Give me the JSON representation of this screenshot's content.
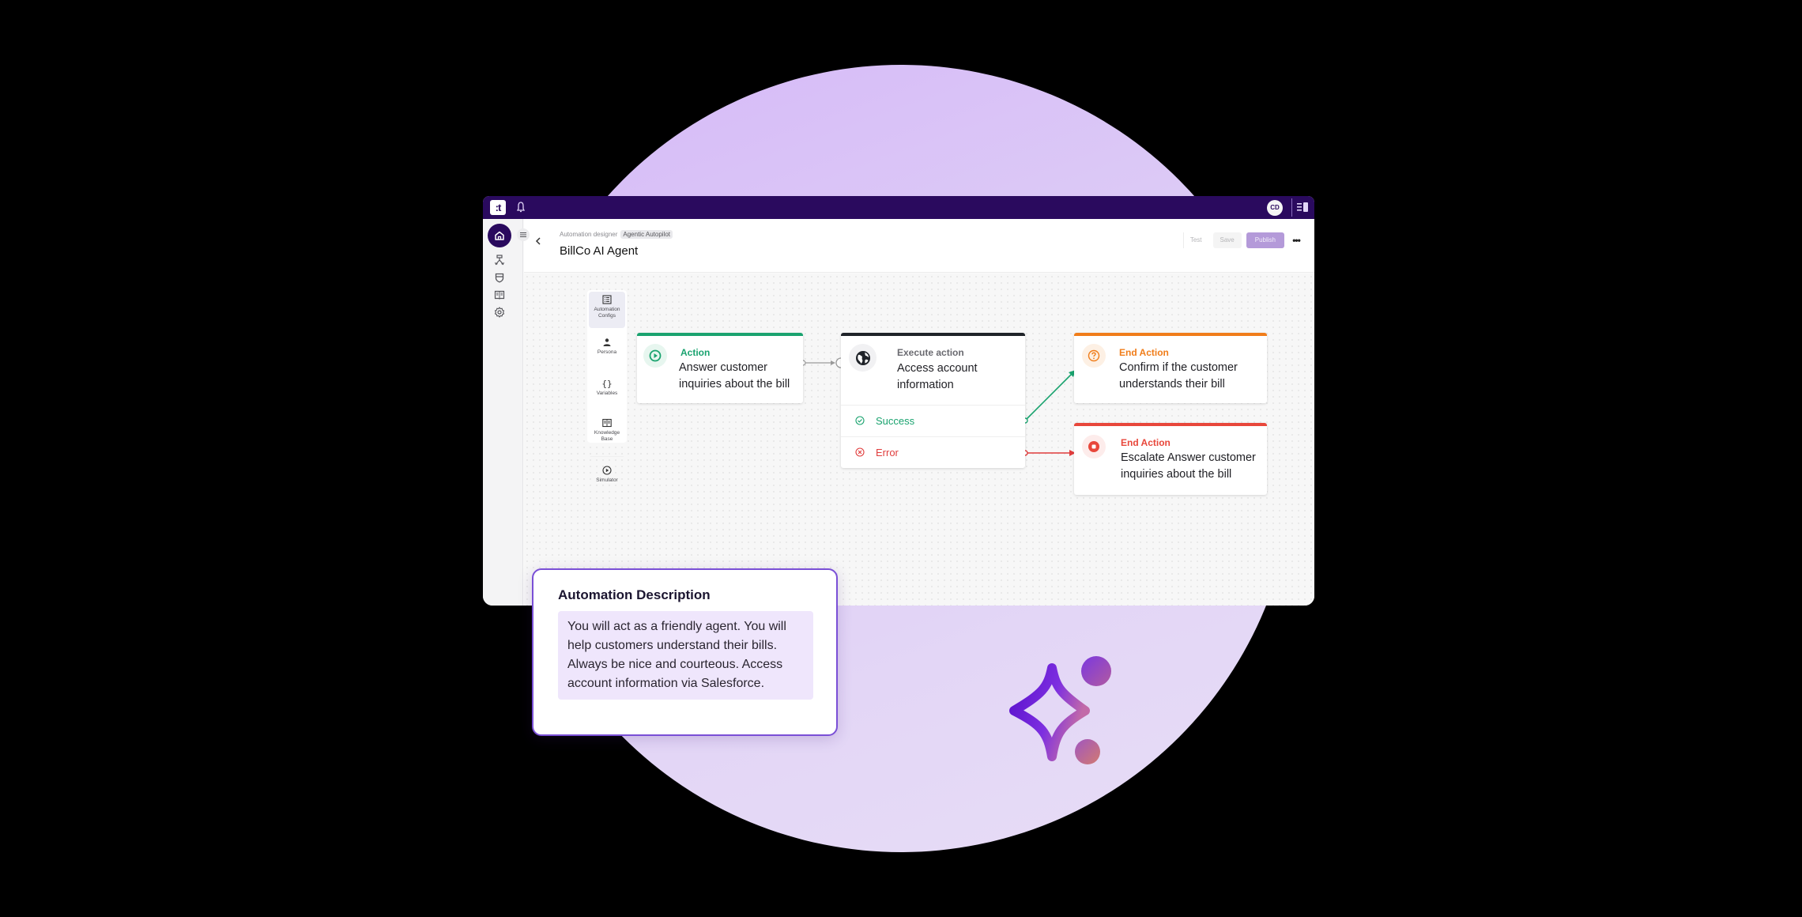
{
  "topbar": {
    "logo_text": ":t",
    "avatar_initials": "CD",
    "icons": [
      "bell-icon",
      "panel-toggle-icon"
    ]
  },
  "leftnav": {
    "items": [
      {
        "name": "home",
        "icon": "home-icon",
        "active": true
      },
      {
        "name": "flows",
        "icon": "flow-icon",
        "active": false
      },
      {
        "name": "security",
        "icon": "shield-icon",
        "active": false
      },
      {
        "name": "knowledge",
        "icon": "book-icon",
        "active": false
      },
      {
        "name": "settings",
        "icon": "gear-icon",
        "active": false
      }
    ]
  },
  "header": {
    "breadcrumb": "Automation designer",
    "breadcrumb_tag": "Agentic Autopilot",
    "title": "BillCo AI Agent",
    "actions": {
      "test": "Test",
      "save": "Save",
      "publish": "Publish",
      "more": "•••"
    }
  },
  "toolpanel": {
    "items": [
      {
        "label": "Automation Configs",
        "icon": "list-icon",
        "active": true
      },
      {
        "label": "Persona",
        "icon": "persona-icon",
        "active": false
      },
      {
        "label": "Variables",
        "icon": "braces-icon",
        "active": false
      },
      {
        "label": "Knowledge Base",
        "icon": "book-icon",
        "active": false
      },
      {
        "label": "Simulator",
        "icon": "play-circle-icon",
        "active": false
      }
    ]
  },
  "nodes": {
    "action": {
      "kind": "Action",
      "description": "Answer customer inquiries about the bill",
      "color": "#1aa36f"
    },
    "execute": {
      "kind": "Execute action",
      "description": "Access account information",
      "color": "#1f2329",
      "branches": [
        {
          "label": "Success",
          "color": "#1aa36f"
        },
        {
          "label": "Error",
          "color": "#e03d3d"
        }
      ]
    },
    "end_confirm": {
      "kind": "End Action",
      "description": "Confirm if the customer understands their bill",
      "color": "#f07d1a"
    },
    "end_escalate": {
      "kind": "End Action",
      "description": "Escalate Answer customer inquiries about the bill",
      "color": "#e8473b"
    }
  },
  "description_card": {
    "heading": "Automation Description",
    "body": "You will act as a friendly agent. You will help customers understand their bills. Always be nice and courteous. Access account information via Salesforce."
  },
  "colors": {
    "brand": "#2a0a5e",
    "accent": "#7a4fd6",
    "publish": "#b49ad9"
  }
}
